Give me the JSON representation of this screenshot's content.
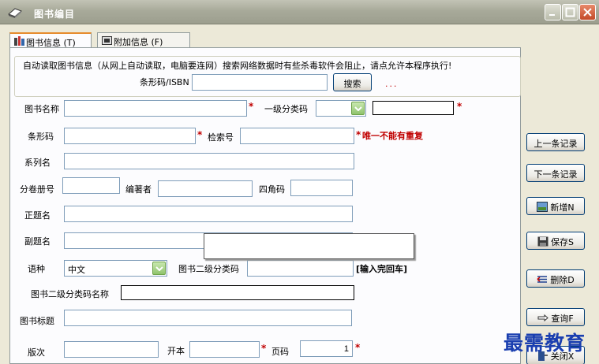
{
  "window": {
    "title": "图书编目"
  },
  "tabs": [
    {
      "label": "图书信息 (T)"
    },
    {
      "label": "附加信息 (F)"
    }
  ],
  "auto_fetch": {
    "caption": "自动读取图书信息（从网上自动读取，电脑要连网）搜索网络数据时有些杀毒软件会阻止，请点允许本程序执行!",
    "barcode_label": "条形码/ISBN",
    "barcode_value": "",
    "search_button": "搜索",
    "progress_dots": "..."
  },
  "form": {
    "book_name": {
      "label": "图书名称",
      "value": "",
      "required": "*"
    },
    "category1": {
      "label": "一级分类码",
      "value": "",
      "extra_value": "",
      "required": "*"
    },
    "barcode": {
      "label": "条形码",
      "value": "",
      "required": "*"
    },
    "call_number": {
      "label": "检索号",
      "value": "",
      "required": "*",
      "warning": "唯一不能有重复"
    },
    "series": {
      "label": "系列名",
      "value": ""
    },
    "volume": {
      "label": "分卷册号",
      "value": ""
    },
    "author": {
      "label": "编著者",
      "value": ""
    },
    "four_corner": {
      "label": "四角码",
      "value": ""
    },
    "main_title": {
      "label": "正题名",
      "value": ""
    },
    "sub_title": {
      "label": "副题名",
      "value": ""
    },
    "language": {
      "label": "语种",
      "value": "中文"
    },
    "category2": {
      "label": "图书二级分类码",
      "value": "",
      "hint": "[输入完回车]"
    },
    "category2_name": {
      "label": "图书二级分类码名称",
      "value": ""
    },
    "book_title": {
      "label": "图书标题",
      "value": ""
    },
    "edition": {
      "label": "版次",
      "value": ""
    },
    "format": {
      "label": "开本",
      "value": "",
      "required": "*"
    },
    "pages": {
      "label": "页码",
      "value": "1",
      "required": "*"
    }
  },
  "side_buttons": {
    "prev": "上一条记录",
    "next": "下一条记录",
    "add": "新增N",
    "save": "保存S",
    "delete": "删除D",
    "query": "查询F",
    "close": "关闭X"
  },
  "watermark": "最需教育",
  "colors": {
    "required": "#c00000",
    "watermark": "#1a3fb0",
    "titlebar": "#a8aa9a"
  }
}
